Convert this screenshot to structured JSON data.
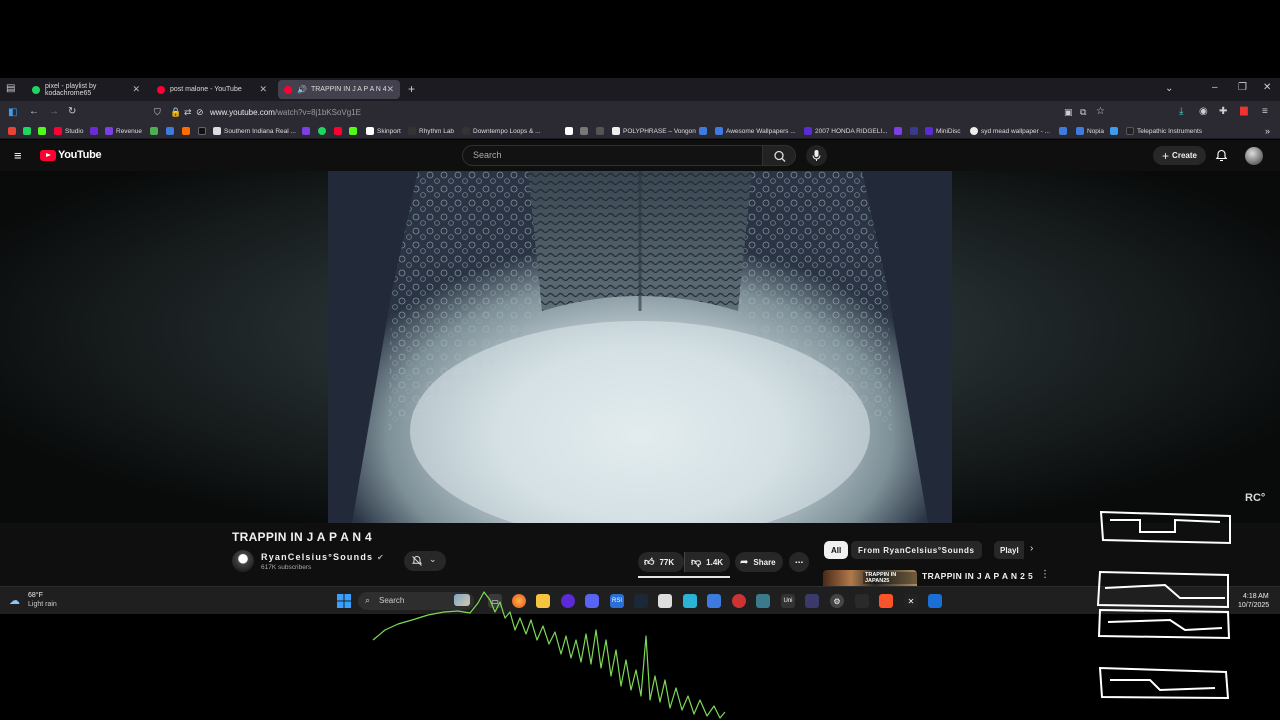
{
  "browser": {
    "tabs": [
      {
        "label": "pixel - playlist by kodachrome65",
        "favicon_color": "#1ed760"
      },
      {
        "label": "post malone - YouTube",
        "favicon_color": "#ff0033"
      },
      {
        "label": "TRAPPIN IN J A P A N 4",
        "favicon_color": "#ff0033"
      }
    ],
    "new_tab_icon": "plus-icon",
    "url_domain": "www.youtube.com",
    "url_path": "/watch?v=8j1bKSoVg1E",
    "bookmarks": [
      {
        "label": "Studio",
        "color": "#ff0033"
      },
      {
        "label": "Revenue",
        "color": "#7b3fe4"
      },
      {
        "label": "Southern Indiana Real ...",
        "color": "#dddddd"
      },
      {
        "label": "Skinport",
        "color": "#ffffff"
      },
      {
        "label": "Rhythm Lab",
        "color": "#333333"
      },
      {
        "label": "Downtempo Loops & ...",
        "color": "#333333"
      },
      {
        "label": "POLYPHRASE – Vongon",
        "color": "#eeeeee"
      },
      {
        "label": "Awesome Wallpapers ...",
        "color": "#3d7be0"
      },
      {
        "label": "2007 HONDA RIDGELI...",
        "color": "#5b2bd6"
      },
      {
        "label": "MiniDisc",
        "color": "#5b2bd6"
      },
      {
        "label": "syd mead wallpaper - ...",
        "color": "#eeeeee"
      },
      {
        "label": "Nopia",
        "color": "#3d7be0"
      },
      {
        "label": "Telepathic Instruments",
        "color": "#222222"
      }
    ]
  },
  "youtube": {
    "logo_text": "YouTube",
    "search_placeholder": "Search",
    "create_label": "Create",
    "video": {
      "title": "TRAPPIN IN J A P A N 4",
      "channel": "RyanCelsius°Sounds",
      "subscribers": "617K subscribers",
      "likes": "77K",
      "dislikes": "1.4K",
      "share_label": "Share",
      "watermark": "RC°"
    },
    "chips": [
      "All",
      "From RyanCelsius°Sounds",
      "Playl"
    ],
    "recommended": {
      "title": "TRAPPIN IN J A P A N 2 5",
      "thumb_text": "TRAPPIN IN JAPAN25"
    }
  },
  "taskbar": {
    "temperature": "68°F",
    "weather": "Light rain",
    "search_label": "Search",
    "time": "4:18 AM",
    "date": "10/7/2025"
  },
  "overlay": {
    "waveform_color": "#7ed957",
    "glyph_color": "#ffffff"
  }
}
